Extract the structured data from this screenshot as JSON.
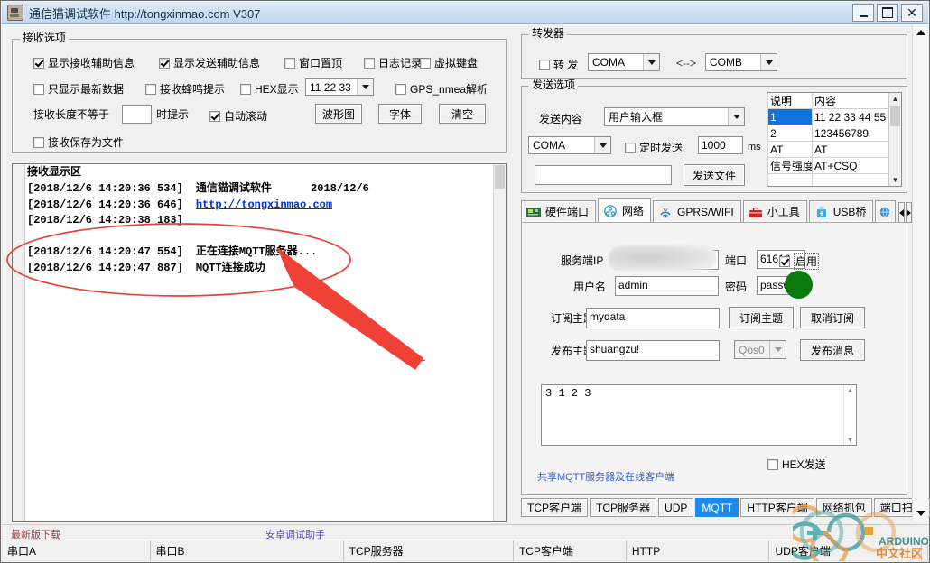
{
  "window": {
    "title": "通信猫调试软件  http://tongxinmao.com  V307",
    "icon": "modem-icon",
    "buttons": {
      "minimize": "_",
      "maximize": "□",
      "close": "✕"
    }
  },
  "receive_options": {
    "legend": "接收选项",
    "row1": [
      {
        "label": "显示接收辅助信息",
        "checked": true
      },
      {
        "label": "显示发送辅助信息",
        "checked": true
      },
      {
        "label": "窗口置顶",
        "checked": false
      },
      {
        "label": "日志记录",
        "checked": false
      },
      {
        "label": "虚拟键盘",
        "checked": false
      }
    ],
    "row2": [
      {
        "label": "只显示最新数据",
        "checked": false
      },
      {
        "label": "接收蜂鸣提示",
        "checked": false
      },
      {
        "label": "HEX显示",
        "checked": false
      }
    ],
    "hex_select": {
      "value": "11 22 33"
    },
    "gps": {
      "label": "GPS_nmea解析",
      "checked": false
    },
    "length_prefix": "接收长度不等于",
    "length_value": "",
    "length_suffix": "时提示",
    "autoscroll": {
      "label": "自动滚动",
      "checked": true
    },
    "buttons": [
      {
        "label": "波形图"
      },
      {
        "label": "字体"
      },
      {
        "label": "清空"
      }
    ],
    "save_file": {
      "label": "接收保存为文件",
      "checked": false
    }
  },
  "receive_display": {
    "title": "接收显示区",
    "lines": [
      {
        "ts": "[2018/12/6 14:20:36 534]",
        "msg": "通信猫调试软件      2018/12/6",
        "link": false
      },
      {
        "ts": "[2018/12/6 14:20:36 646]",
        "msg": "http://tongxinmao.com",
        "link": true
      },
      {
        "ts": "[2018/12/6 14:20:38 183]",
        "msg": "",
        "link": false
      },
      {
        "ts": "",
        "msg": "",
        "link": false
      },
      {
        "ts": "[2018/12/6 14:20:47 554]",
        "msg": "正在连接MQTT服务器...",
        "link": false
      },
      {
        "ts": "[2018/12/6 14:20:47 887]",
        "msg": "MQTT连接成功",
        "link": false
      }
    ]
  },
  "annotation": {
    "color": "#e8413c",
    "shape": "ellipse-and-arrow"
  },
  "forwarder": {
    "legend": "转发器",
    "enable": {
      "label": "转 发",
      "checked": false
    },
    "port_a": "COMA",
    "link_symbol": "<-->",
    "port_b": "COMB"
  },
  "send_options": {
    "legend": "发送选项",
    "content_label": "发送内容",
    "content_value": "用户输入框",
    "port_value": "COMA",
    "timer": {
      "label": "定时发送",
      "checked": false
    },
    "timer_value": "1000",
    "timer_unit": "ms",
    "file_path": "",
    "send_file_button": "发送文件",
    "table": {
      "headers": [
        "说明",
        "内容"
      ],
      "rows": [
        {
          "name": "1",
          "content": "11 22 33 44 55",
          "selected": true
        },
        {
          "name": "2",
          "content": "123456789",
          "selected": false
        },
        {
          "name": "AT",
          "content": "AT",
          "selected": false
        },
        {
          "name": "信号强度",
          "content": "AT+CSQ",
          "selected": false
        },
        {
          "name": "",
          "content": "",
          "selected": false
        }
      ]
    }
  },
  "icon_tabs": {
    "items": [
      {
        "label": "硬件端口",
        "icon": "circuit-board-icon",
        "active": false
      },
      {
        "label": "网络",
        "icon": "network-icon",
        "active": true
      },
      {
        "label": "GPRS/WIFI",
        "icon": "antenna-icon",
        "active": false
      },
      {
        "label": "小工具",
        "icon": "toolbox-icon",
        "active": false
      },
      {
        "label": "USB桥",
        "icon": "usb-icon",
        "active": false
      },
      {
        "label": "",
        "icon": "globe-icon",
        "active": false
      }
    ],
    "nav_prev": "◀",
    "nav_next": "▶"
  },
  "mqtt": {
    "server_ip_label": "服务端IP",
    "server_ip_value": "",
    "server_ip_redacted": true,
    "port_label": "端口",
    "port_value": "61613",
    "enable": {
      "label": "启用",
      "checked": true
    },
    "username_label": "用户名",
    "username_value": "admin",
    "password_label": "密码",
    "password_value": "passwo",
    "status_indicator_color": "#0a7a0a",
    "subscribe_topic_label": "订阅主题",
    "subscribe_topic_value": "mydata",
    "subscribe_button": "订阅主题",
    "unsubscribe_button": "取消订阅",
    "publish_topic_label": "发布主题",
    "publish_topic_value": "shuangzu!",
    "qos_value": "Qos0",
    "publish_button": "发布消息",
    "message_value": "3 1 2 3",
    "hex_send": {
      "label": "HEX发送",
      "checked": false
    },
    "share_link": "共享MQTT服务器及在线客户端"
  },
  "bottom_tabs": [
    {
      "label": "TCP客户端",
      "active": false
    },
    {
      "label": "TCP服务器",
      "active": false
    },
    {
      "label": "UDP",
      "active": false
    },
    {
      "label": "MQTT",
      "active": true
    },
    {
      "label": "HTTP客户端",
      "active": false
    },
    {
      "label": "网络抓包",
      "active": false
    },
    {
      "label": "端口扫描",
      "active": false
    }
  ],
  "links_bar": {
    "download": "最新版下载",
    "android": "安卓调试助手"
  },
  "status_bar": [
    {
      "label": "串口A"
    },
    {
      "label": "串口B"
    },
    {
      "label": "TCP服务器"
    },
    {
      "label": "TCP客户端"
    },
    {
      "label": "HTTP"
    },
    {
      "label": "UDP客户端"
    },
    {
      "label": ""
    }
  ],
  "watermark": {
    "text1": "ARDUINO",
    "text2": "中文社区"
  }
}
